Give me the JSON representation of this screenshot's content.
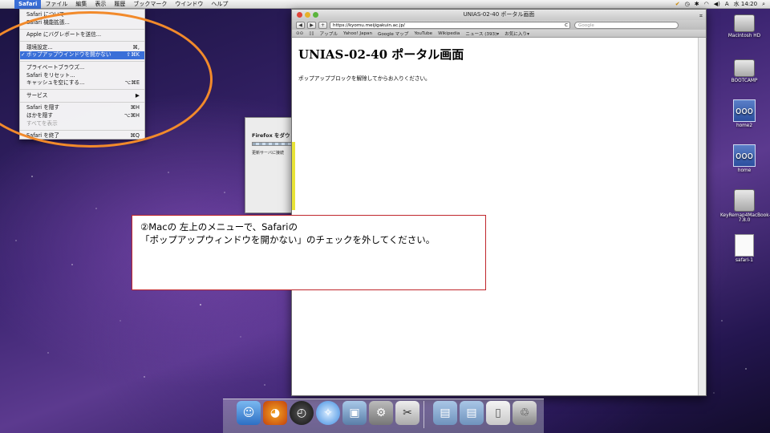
{
  "menubar": {
    "apple": "",
    "items": [
      "Safari",
      "ファイル",
      "編集",
      "表示",
      "履歴",
      "ブックマーク",
      "ウインドウ",
      "ヘルプ"
    ],
    "clock": "水 14:20"
  },
  "safari_menu": {
    "about": "Safari について",
    "extensions": "Safari 機能拡張...",
    "bug_report": "Apple にバグレポートを送信...",
    "preferences": "環境設定...",
    "preferences_shortcut": "⌘,",
    "block_popups": "ポップアップウインドウを開かない",
    "block_popups_check": "✓",
    "block_popups_shortcut": "⇧⌘K",
    "private": "プライベートブラウズ...",
    "reset": "Safari をリセット...",
    "empty_cache": "キャッシュを空にする...",
    "empty_cache_shortcut": "⌥⌘E",
    "services": "サービス",
    "services_arrow": "▶",
    "hide": "Safari を隠す",
    "hide_shortcut": "⌘H",
    "hide_others": "ほかを隠す",
    "hide_others_shortcut": "⌥⌘H",
    "show_all": "すべてを表示",
    "quit": "Safari を終了",
    "quit_shortcut": "⌘Q"
  },
  "firefox_dialog": {
    "title": "Firefox をダウ",
    "status": "更新サーバに接続"
  },
  "safari_window": {
    "title": "UNIAS-02-40 ポータル画面",
    "url": "https://kyomu.meijigakuin.ac.jp/",
    "search_placeholder": "Google",
    "back": "◀",
    "forward": "▶",
    "add": "+",
    "reload": "C",
    "bookmarks": [
      "アップル",
      "Yahoo! Japan",
      "Google マップ",
      "YouTube",
      "Wikipedia",
      "ニュース (393)▾",
      "お気に入り▾"
    ],
    "heading": "UNIAS-02-40 ポータル画面",
    "message": "ポップアップブロックを解除してからお入りください。"
  },
  "annotation": {
    "line1": "②Macの 左上のメニューで、Safariの",
    "line2": "「ポップアップウィンドウを開かない」のチェックを外してください。"
  },
  "desktop_icons": {
    "hd": "Macintosh HD",
    "bootcamp": "BOOTCAMP",
    "home2": "home2",
    "home": "home",
    "keyremap": "KeyRemap4MacBook-7.8.0",
    "safari_doc": "safari-1"
  }
}
